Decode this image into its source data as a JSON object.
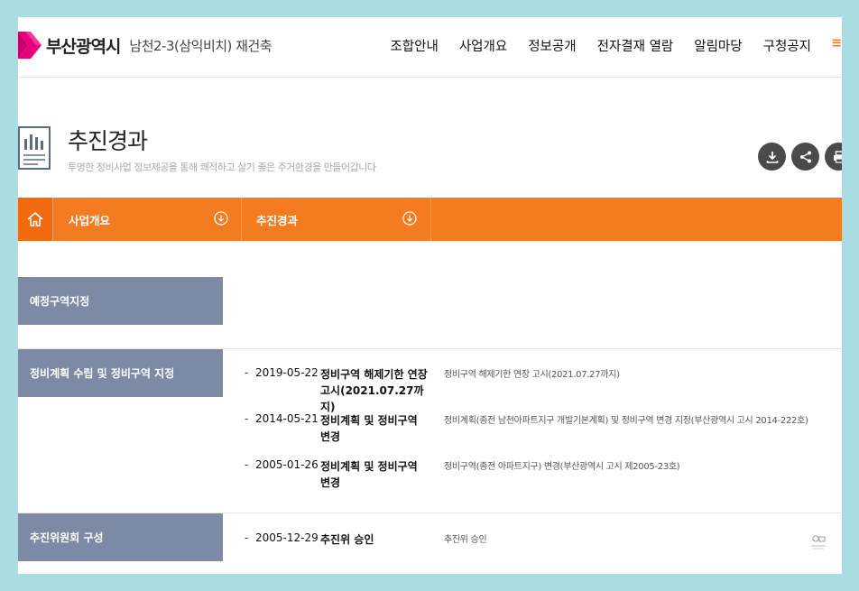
{
  "header": {
    "logo_city": "부산광역시",
    "logo_sub": "남천2-3(삼익비치) 재건축",
    "nav": [
      "조합안내",
      "사업개요",
      "정보공개",
      "전자결재 열람",
      "알림마당",
      "구청공지"
    ],
    "nav_extra": "≡"
  },
  "page": {
    "title": "추진경과",
    "desc": "투명한 정비사업 정보제공을 통해 쾌적하고 살기 좋은 주거환경을 만들어갑니다"
  },
  "location": {
    "depth1": "사업개요",
    "depth2": "추진경과"
  },
  "colors": {
    "accent": "#f47b20",
    "section_label_bg": "#7d8aa5"
  },
  "timeline": [
    {
      "label": "예정구역지정",
      "entries": []
    },
    {
      "label": "정비계획 수립 및 정비구역 지정",
      "entries": [
        {
          "dash": "-",
          "date": "2019-05-22",
          "title": "정비구역 해제기한 연장 고시(2021.07.27까지)",
          "desc": "정비구역 해제기한 연장 고시(2021.07.27까지)"
        },
        {
          "dash": "-",
          "date": "2014-05-21",
          "title": "정비계획 및 정비구역 변경",
          "desc": "정비계획(종전 남천아파트지구 개발기본계획) 및 정비구역 변경 지정(부산광역시 고시 2014-222호)"
        },
        {
          "dash": "-",
          "date": "2005-01-26",
          "title": "정비계획 및 정비구역 변경",
          "desc": "정비구역(종전 아파트지구) 변경(부산광역시 고시 제2005-23호)"
        }
      ]
    },
    {
      "label": "추진위원회 구성",
      "entries": [
        {
          "dash": "-",
          "date": "2005-12-29",
          "title": "추진위 승인",
          "desc": "추진위 승인"
        }
      ]
    }
  ]
}
